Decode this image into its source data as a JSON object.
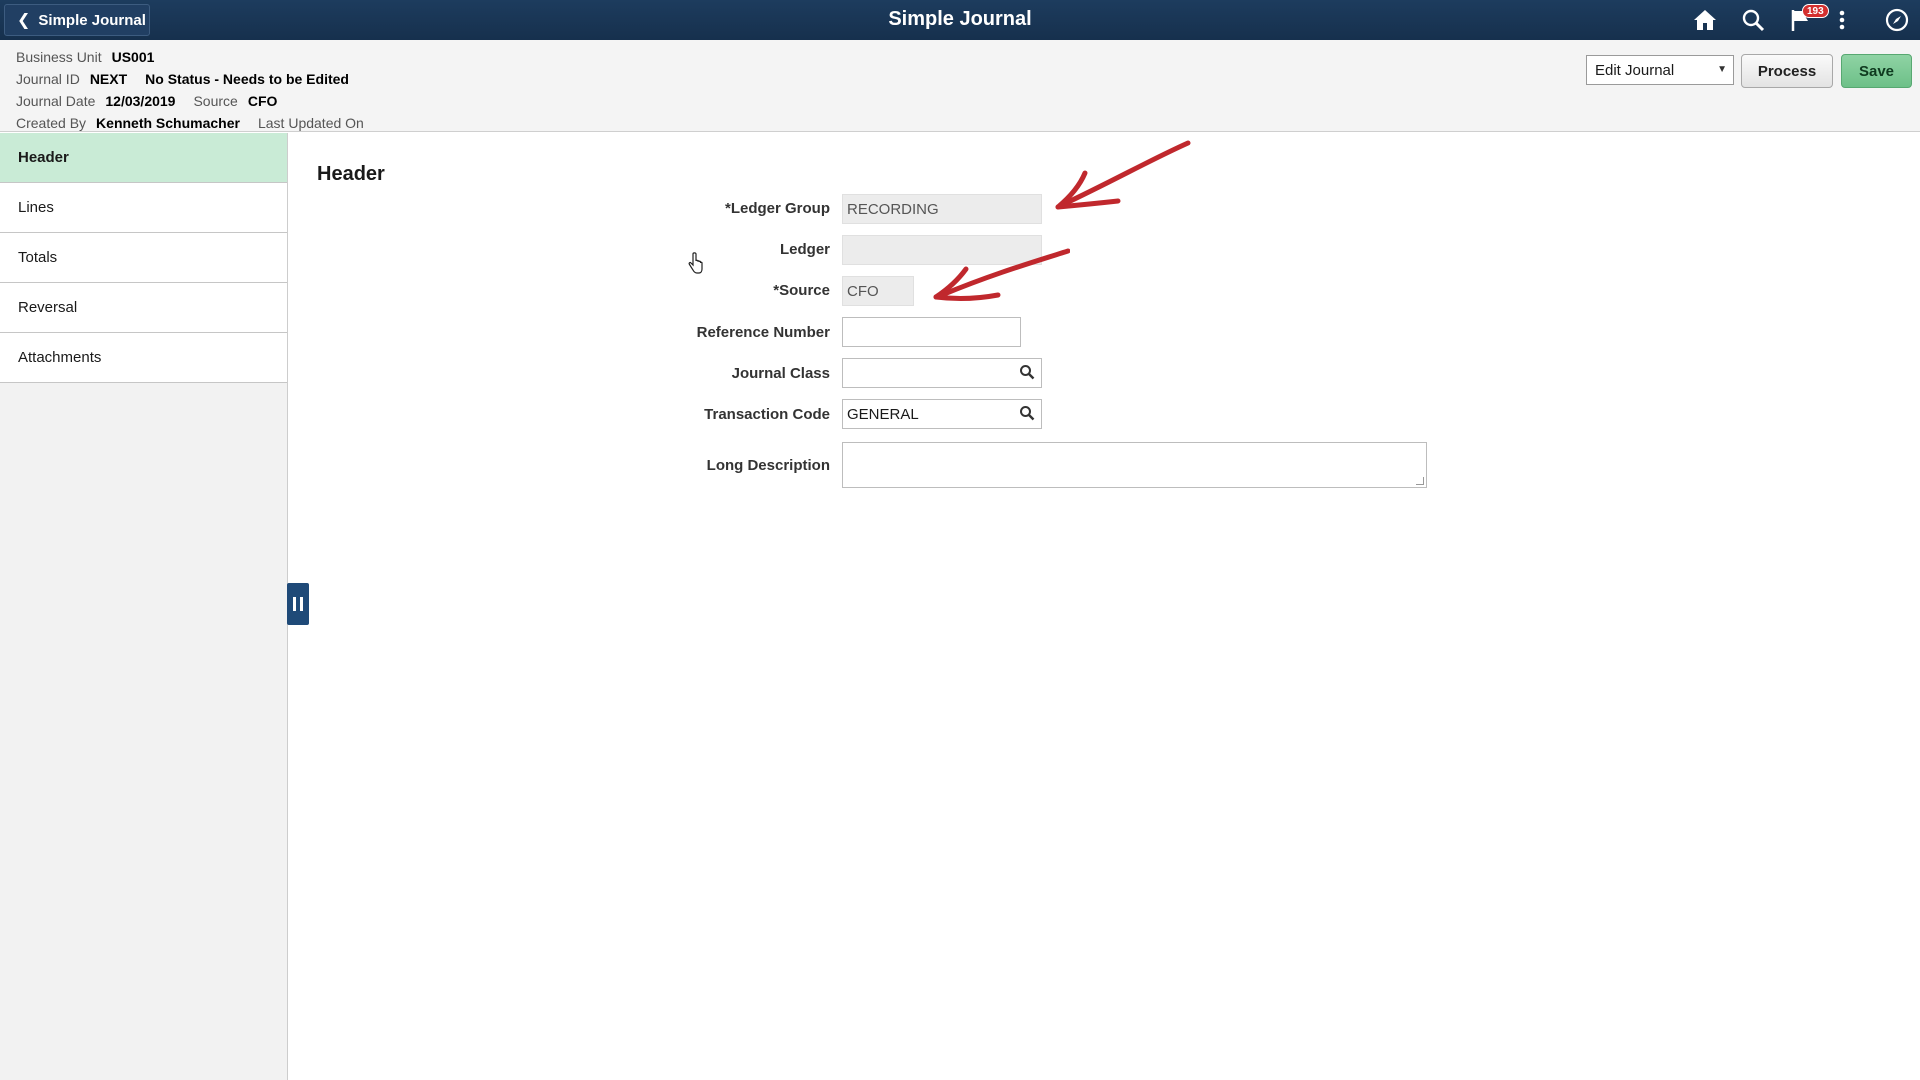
{
  "banner": {
    "back_label": "Simple Journal",
    "title": "Simple Journal",
    "notification_count": "193",
    "icons": [
      "home-icon",
      "search-icon",
      "notification-flag-icon",
      "more-actions-icon",
      "navbar-compass-icon"
    ]
  },
  "info": {
    "business_unit_label": "Business Unit",
    "business_unit": "US001",
    "journal_id_label": "Journal ID",
    "journal_id": "NEXT",
    "status": "No Status - Needs to be Edited",
    "journal_date_label": "Journal Date",
    "journal_date": "12/03/2019",
    "source_label": "Source",
    "source": "CFO",
    "created_by_label": "Created By",
    "created_by": "Kenneth Schumacher",
    "last_updated_label": "Last Updated On"
  },
  "toolbar": {
    "action_select": "Edit Journal",
    "process_label": "Process",
    "save_label": "Save",
    "save_color": "#6dc088"
  },
  "sidebar": {
    "items": [
      {
        "label": "Header",
        "active": true
      },
      {
        "label": "Lines"
      },
      {
        "label": "Totals"
      },
      {
        "label": "Reversal"
      },
      {
        "label": "Attachments"
      }
    ],
    "active_color": "#c9ebd6"
  },
  "form": {
    "section_title": "Header",
    "ledger_group_label": "*Ledger Group",
    "ledger_group_value": "RECORDING",
    "ledger_label": "Ledger",
    "ledger_value": "",
    "source_label": "*Source",
    "source_value": "CFO",
    "reference_number_label": "Reference Number",
    "reference_number_value": "",
    "journal_class_label": "Journal Class",
    "journal_class_value": "",
    "transaction_code_label": "Transaction Code",
    "transaction_code_value": "GENERAL",
    "long_description_label": "Long Description",
    "long_description_value": ""
  },
  "annotation_color": "#c0282d"
}
